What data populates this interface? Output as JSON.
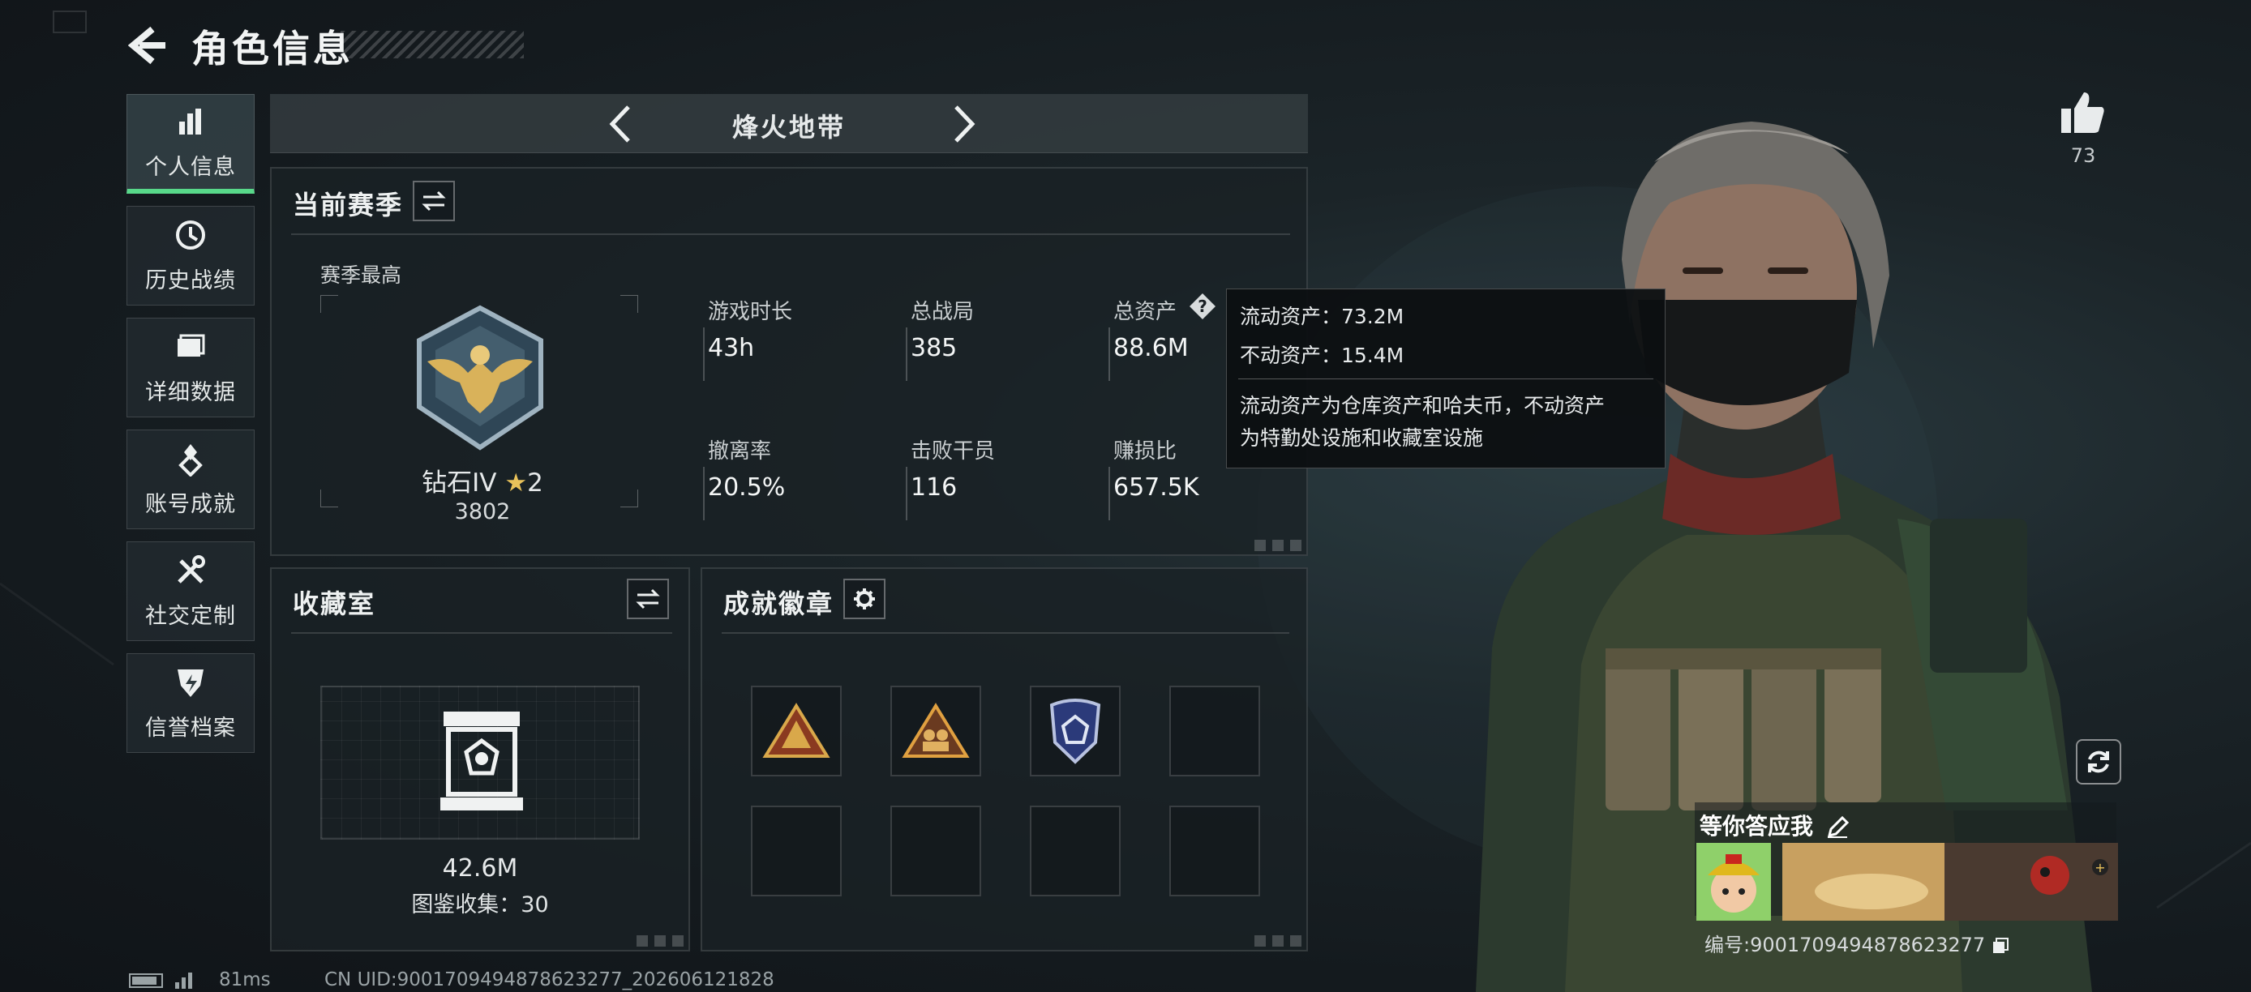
{
  "header": {
    "title": "角色信息"
  },
  "sidebar": {
    "items": [
      {
        "label": "个人信息",
        "icon": "bar-chart-icon",
        "active": true
      },
      {
        "label": "历史战绩",
        "icon": "clock-icon",
        "active": false
      },
      {
        "label": "详细数据",
        "icon": "folder-icon",
        "active": false
      },
      {
        "label": "账号成就",
        "icon": "medal-icon",
        "active": false
      },
      {
        "label": "社交定制",
        "icon": "tools-icon",
        "active": false
      },
      {
        "label": "信誉档案",
        "icon": "shield-icon",
        "active": false
      }
    ]
  },
  "mode": {
    "name": "烽火地带"
  },
  "season": {
    "title": "当前赛季",
    "best_label": "赛季最高",
    "rank": "钻石IV",
    "stars": "2",
    "score": "3802",
    "stats": [
      {
        "label": "游戏时长",
        "value": "43h"
      },
      {
        "label": "总战局",
        "value": "385"
      },
      {
        "label": "总资产",
        "value": "88.6M"
      },
      {
        "label": "撤离率",
        "value": "20.5%"
      },
      {
        "label": "击败干员",
        "value": "116"
      },
      {
        "label": "赚损比",
        "value": "657.5K"
      }
    ]
  },
  "tooltip": {
    "liquid": "流动资产：73.2M",
    "fixed": "不动资产：15.4M",
    "desc_line1": "流动资产为仓库资产和哈夫币，不动资产",
    "desc_line2": "为特勤处设施和收藏室设施"
  },
  "collection": {
    "title": "收藏室",
    "value": "42.6M",
    "catalog": "图鉴收集：30"
  },
  "badges": {
    "title": "成就徽章",
    "items": [
      "badge-triangle-gold",
      "badge-triangle-soldiers",
      "badge-shield-blue",
      "",
      "",
      "",
      "",
      ""
    ]
  },
  "profile": {
    "likes": "73",
    "card_name": "等你答应我",
    "uid": "编号:9001709494878623277"
  },
  "footer": {
    "ping": "81ms",
    "uid_line": "CN UID:9001709494878623277_202606121828"
  },
  "colors": {
    "accent": "#58d98a",
    "star": "#e9c25a"
  }
}
